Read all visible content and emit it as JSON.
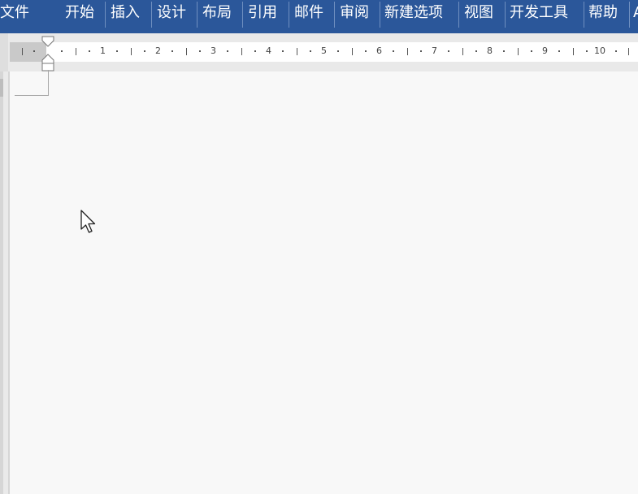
{
  "ribbon": {
    "tabs": [
      {
        "label": "文件"
      },
      {
        "label": "开始"
      },
      {
        "label": "插入"
      },
      {
        "label": "设计"
      },
      {
        "label": "布局"
      },
      {
        "label": "引用"
      },
      {
        "label": "邮件"
      },
      {
        "label": "审阅"
      },
      {
        "label": "新建选项"
      },
      {
        "label": "视图"
      },
      {
        "label": "开发工具"
      },
      {
        "label": "帮助"
      },
      {
        "label": "A"
      }
    ]
  },
  "ruler": {
    "numbers": [
      "1",
      "2",
      "3",
      "4",
      "5",
      "6",
      "7",
      "8",
      "9",
      "10"
    ]
  },
  "icons": {
    "indent_marker": "first-line-and-hanging-indent-marker-icon",
    "cursor": "mouse-pointer-icon"
  },
  "colors": {
    "ribbon_background": "#2b579a",
    "ribbon_text": "#ffffff",
    "page_background": "#f8f8f8"
  }
}
